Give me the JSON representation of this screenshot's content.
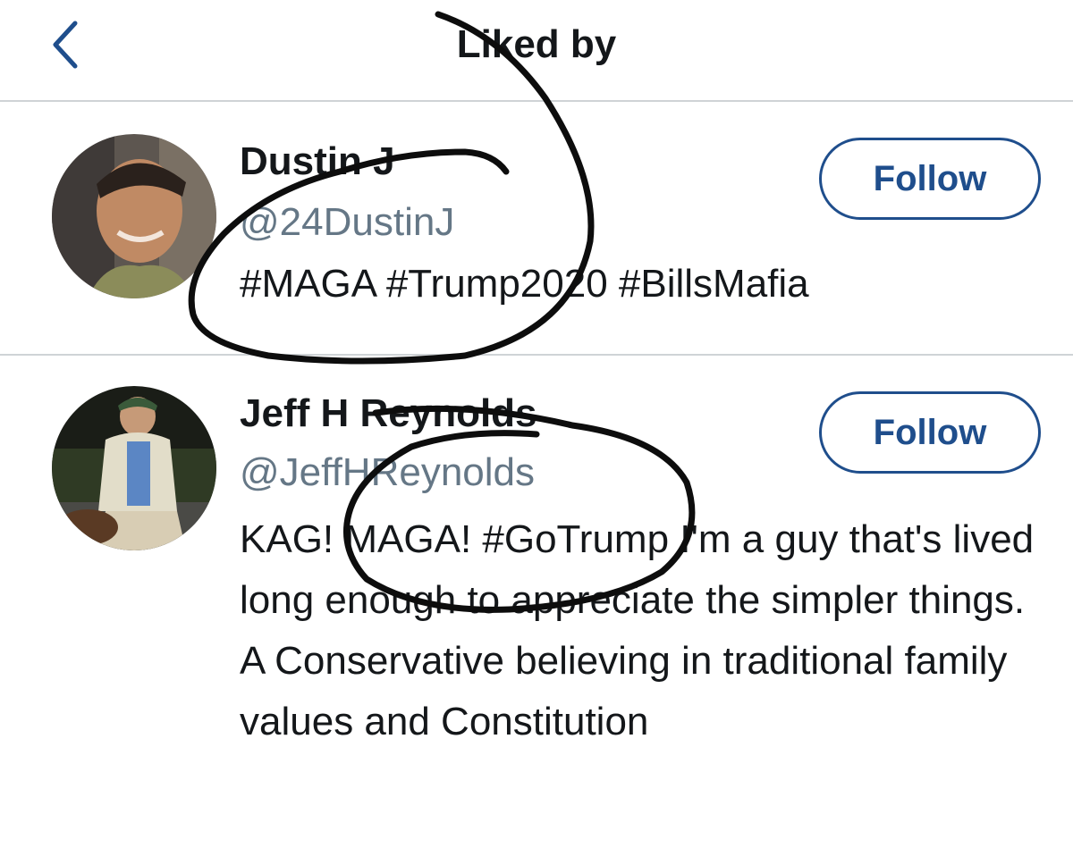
{
  "header": {
    "title": "Liked by",
    "back_icon": "chevron-left-icon"
  },
  "users": [
    {
      "name": "Dustin J",
      "handle": "@24DustinJ",
      "bio": "#MAGA #Trump2020 #BillsMafia",
      "follow_label": "Follow"
    },
    {
      "name": "Jeff H Reynolds",
      "handle": "@JeffHReynolds",
      "bio": "KAG! MAGA! #GoTrump I'm a guy that's lived long enough to appreciate the simpler things. A Conservative believing in traditional family values and Constitution",
      "follow_label": "Follow"
    }
  ],
  "colors": {
    "accent": "#1f4e8c",
    "handle": "#657786",
    "divider": "#cfd3d6",
    "text": "#14171a",
    "annotation_ink": "#0d0d0d"
  }
}
